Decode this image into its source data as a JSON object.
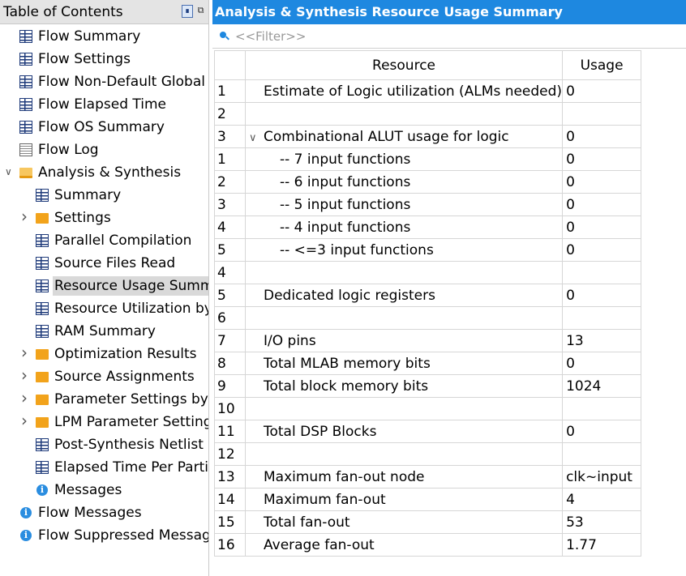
{
  "toc": {
    "title": "Table of Contents",
    "pin_icon": "pin-icon",
    "float_icon": "float-window-icon",
    "items": [
      {
        "label": "Flow Summary",
        "icon": "table-icon",
        "level": 0
      },
      {
        "label": "Flow Settings",
        "icon": "table-icon",
        "level": 0
      },
      {
        "label": "Flow Non-Default Global Settings",
        "icon": "table-icon",
        "level": 0
      },
      {
        "label": "Flow Elapsed Time",
        "icon": "table-icon",
        "level": 0
      },
      {
        "label": "Flow OS Summary",
        "icon": "table-icon",
        "level": 0
      },
      {
        "label": "Flow Log",
        "icon": "document-icon",
        "level": 0
      },
      {
        "label": "Analysis & Synthesis",
        "icon": "folder-open-icon",
        "level": 0,
        "expanded": true
      },
      {
        "label": "Summary",
        "icon": "table-icon",
        "level": 1
      },
      {
        "label": "Settings",
        "icon": "folder-icon",
        "level": 1,
        "collapsed": true
      },
      {
        "label": "Parallel Compilation",
        "icon": "table-icon",
        "level": 1
      },
      {
        "label": "Source Files Read",
        "icon": "table-icon",
        "level": 1
      },
      {
        "label": "Resource Usage Summary",
        "icon": "table-icon",
        "level": 1,
        "selected": true
      },
      {
        "label": "Resource Utilization by Entity",
        "icon": "table-icon",
        "level": 1
      },
      {
        "label": "RAM Summary",
        "icon": "table-icon",
        "level": 1
      },
      {
        "label": "Optimization Results",
        "icon": "folder-icon",
        "level": 1,
        "collapsed": true
      },
      {
        "label": "Source Assignments",
        "icon": "folder-icon",
        "level": 1,
        "collapsed": true
      },
      {
        "label": "Parameter Settings by Entity Instance",
        "icon": "folder-icon",
        "level": 1,
        "collapsed": true
      },
      {
        "label": "LPM Parameter Settings",
        "icon": "folder-icon",
        "level": 1,
        "collapsed": true
      },
      {
        "label": "Post-Synthesis Netlist Statistics",
        "icon": "table-icon",
        "level": 1
      },
      {
        "label": "Elapsed Time Per Partition",
        "icon": "table-icon",
        "level": 1
      },
      {
        "label": "Messages",
        "icon": "info-icon",
        "level": 1
      },
      {
        "label": "Flow Messages",
        "icon": "info-icon",
        "level": 0
      },
      {
        "label": "Flow Suppressed Messages",
        "icon": "info-icon",
        "level": 0
      }
    ]
  },
  "main": {
    "title": "Analysis & Synthesis Resource Usage Summary",
    "filter_placeholder": "<<Filter>>",
    "columns": {
      "resource": "Resource",
      "usage": "Usage"
    },
    "rows": [
      {
        "num": "1",
        "resource": "Estimate of Logic utilization (ALMs needed)",
        "usage": "0",
        "indent": 0
      },
      {
        "num": "2",
        "resource": "",
        "usage": "",
        "indent": 0
      },
      {
        "num": "3",
        "resource": "Combinational ALUT usage for logic",
        "usage": "0",
        "indent": 0,
        "expandable": true
      },
      {
        "num": "1",
        "resource": "-- 7 input functions",
        "usage": "0",
        "indent": 1
      },
      {
        "num": "2",
        "resource": "-- 6 input functions",
        "usage": "0",
        "indent": 1
      },
      {
        "num": "3",
        "resource": "-- 5 input functions",
        "usage": "0",
        "indent": 1
      },
      {
        "num": "4",
        "resource": "-- 4 input functions",
        "usage": "0",
        "indent": 1
      },
      {
        "num": "5",
        "resource": "-- <=3 input functions",
        "usage": "0",
        "indent": 1
      },
      {
        "num": "4",
        "resource": "",
        "usage": "",
        "indent": 0
      },
      {
        "num": "5",
        "resource": "Dedicated logic registers",
        "usage": "0",
        "indent": 0
      },
      {
        "num": "6",
        "resource": "",
        "usage": "",
        "indent": 0
      },
      {
        "num": "7",
        "resource": "I/O pins",
        "usage": "13",
        "indent": 0
      },
      {
        "num": "8",
        "resource": "Total MLAB memory bits",
        "usage": "0",
        "indent": 0
      },
      {
        "num": "9",
        "resource": "Total block memory bits",
        "usage": "1024",
        "indent": 0
      },
      {
        "num": "10",
        "resource": "",
        "usage": "",
        "indent": 0
      },
      {
        "num": "11",
        "resource": "Total DSP Blocks",
        "usage": "0",
        "indent": 0
      },
      {
        "num": "12",
        "resource": "",
        "usage": "",
        "indent": 0
      },
      {
        "num": "13",
        "resource": "Maximum fan-out node",
        "usage": "clk~input",
        "indent": 0
      },
      {
        "num": "14",
        "resource": "Maximum fan-out",
        "usage": "4",
        "indent": 0
      },
      {
        "num": "15",
        "resource": "Total fan-out",
        "usage": "53",
        "indent": 0
      },
      {
        "num": "16",
        "resource": "Average fan-out",
        "usage": "1.77",
        "indent": 0
      }
    ]
  },
  "colors": {
    "title_bar": "#1e88e0",
    "toc_header": "#e4e4e4",
    "selection": "#d9d9d9",
    "folder": "#f2a31b",
    "info": "#2a8de0"
  }
}
